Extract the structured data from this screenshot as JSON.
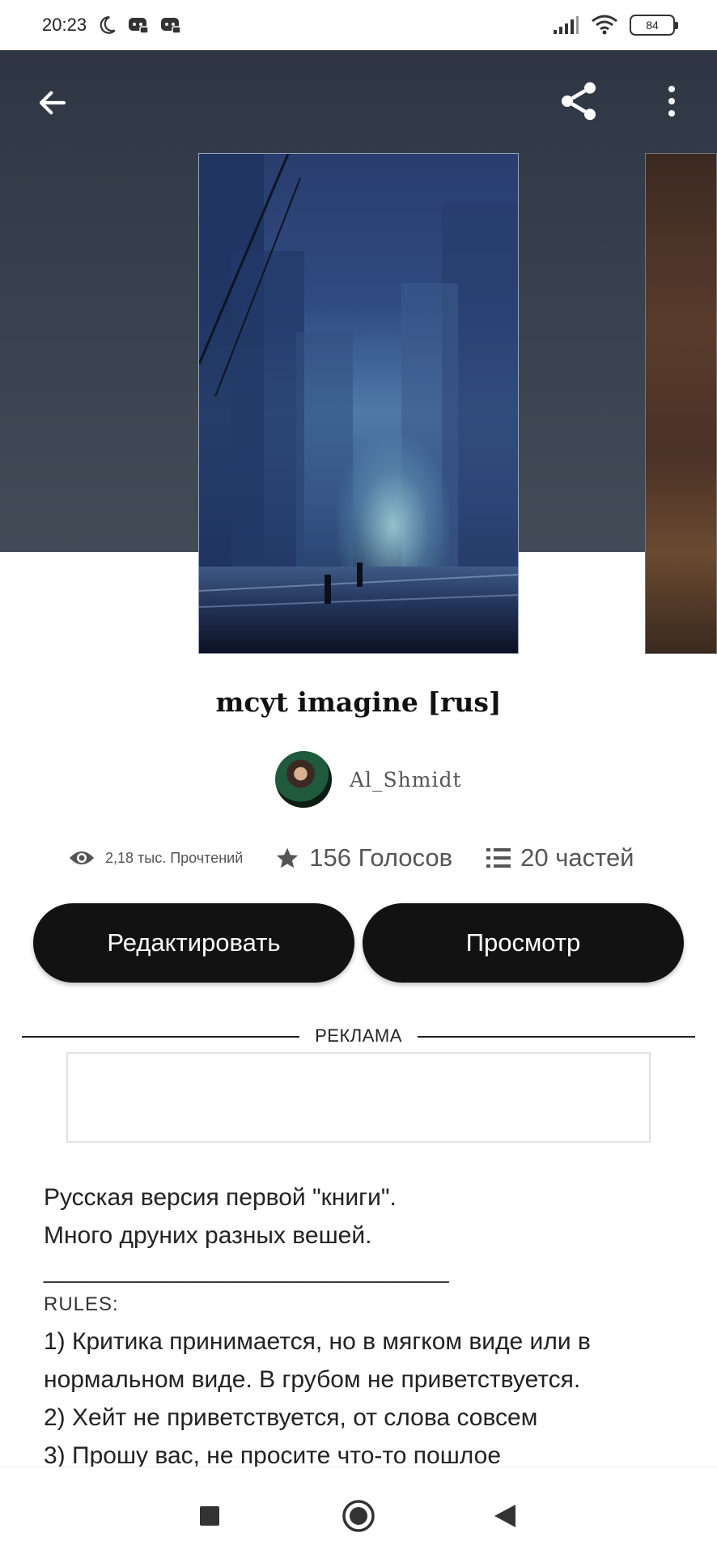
{
  "status_bar": {
    "time": "20:23",
    "battery": "84",
    "icons": [
      "moon-icon",
      "discord-icon",
      "discord-icon",
      "signal-icon",
      "wifi-icon",
      "battery-icon"
    ]
  },
  "top_bar": {
    "back_icon": "arrow-left-icon",
    "share_icon": "share-icon",
    "more_icon": "more-vertical-icon"
  },
  "story": {
    "title": "mcyt imagine [rus]",
    "author": "Al_Shmidt"
  },
  "stats": {
    "reads": "2,18 тыс. Прочтений",
    "votes": "156 Голосов",
    "parts": "20 частей"
  },
  "actions": {
    "edit_label": "Редактировать",
    "view_label": "Просмотр"
  },
  "ad": {
    "label": "РЕКЛАМА"
  },
  "description": {
    "line1": "Русская версия первой \"книги\".",
    "line2": "Много друних разных вешей.",
    "separator": "______________________________",
    "rules_heading": "RULES:",
    "rule1": "1) Критика принимается, но в мягком виде или в нормальном виде. В грубом не приветствуется.",
    "rule2": "2) Хейт не приветствуется, от слова совсем",
    "rule3": "3) Прошу вас, не просите что-то пошлое"
  },
  "colors": {
    "header_bg": "#343c48",
    "button_bg": "#121212",
    "button_text": "#ffffff"
  }
}
